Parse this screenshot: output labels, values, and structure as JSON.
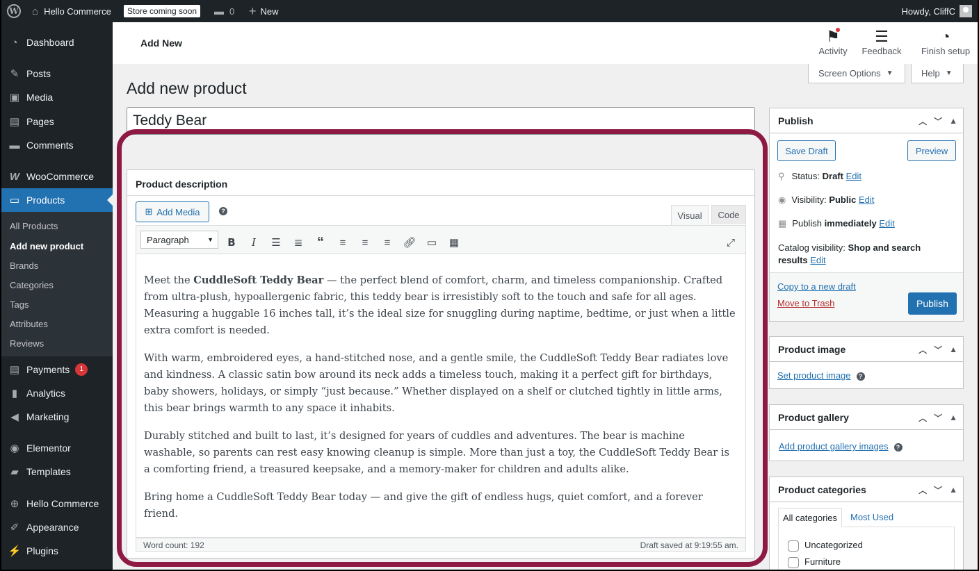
{
  "adminbar": {
    "site_name": "Hello Commerce",
    "store_badge": "Store coming soon",
    "comments_count": "0",
    "new_label": "New",
    "howdy": "Howdy, CliffC"
  },
  "sidebar": {
    "items": [
      {
        "label": "Dashboard",
        "icon": "dashboard-icon"
      },
      {
        "label": "Posts",
        "icon": "pin-icon"
      },
      {
        "label": "Media",
        "icon": "media-icon"
      },
      {
        "label": "Pages",
        "icon": "pages-icon"
      },
      {
        "label": "Comments",
        "icon": "comment-icon"
      },
      {
        "label": "WooCommerce",
        "icon": "woocommerce-icon"
      },
      {
        "label": "Products",
        "icon": "products-icon"
      },
      {
        "label": "Payments",
        "icon": "payments-icon",
        "badge": "1"
      },
      {
        "label": "Analytics",
        "icon": "analytics-icon"
      },
      {
        "label": "Marketing",
        "icon": "megaphone-icon"
      },
      {
        "label": "Elementor",
        "icon": "elementor-icon"
      },
      {
        "label": "Templates",
        "icon": "folder-icon"
      },
      {
        "label": "Hello Commerce",
        "icon": "plus-circle-icon"
      },
      {
        "label": "Appearance",
        "icon": "brush-icon"
      },
      {
        "label": "Plugins",
        "icon": "plug-icon"
      }
    ],
    "submenu": [
      "All Products",
      "Add new product",
      "Brands",
      "Categories",
      "Tags",
      "Attributes",
      "Reviews"
    ]
  },
  "header": {
    "title": "Add New",
    "activity": "Activity",
    "feedback": "Feedback",
    "finish_setup": "Finish setup"
  },
  "screen_options": "Screen Options",
  "help": "Help",
  "page_title": "Add new product",
  "product_title": "Teddy Bear",
  "description": {
    "heading": "Product description",
    "add_media": "Add Media",
    "tab_visual": "Visual",
    "tab_code": "Code",
    "format": "Paragraph",
    "p1_a": "Meet the ",
    "p1_b": "CuddleSoft Teddy Bear",
    "p1_c": " — the perfect blend of comfort, charm, and timeless companionship. Crafted from ultra-plush, hypoallergenic fabric, this teddy bear is irresistibly soft to the touch and safe for all ages. Measuring a huggable 16 inches tall, it’s the ideal size for snuggling during naptime, bedtime, or just when a little extra comfort is needed.",
    "p2": "With warm, embroidered eyes, a hand-stitched nose, and a gentle smile, the CuddleSoft Teddy Bear radiates love and kindness. A classic satin bow around its neck adds a timeless touch, making it a perfect gift for birthdays, baby showers, holidays, or simply “just because.” Whether displayed on a shelf or clutched tightly in little arms, this bear brings warmth to any space it inhabits.",
    "p3": "Durably stitched and built to last, it’s designed for years of cuddles and adventures. The bear is machine washable, so parents can rest easy knowing cleanup is simple. More than just a toy, the CuddleSoft Teddy Bear is a comforting friend, a treasured keepsake, and a memory-maker for children and adults alike.",
    "p4": "Bring home a CuddleSoft Teddy Bear today — and give the gift of endless hugs, quiet comfort, and a forever friend.",
    "word_count": "Word count: 192",
    "draft_saved": "Draft saved at 9:19:55 am."
  },
  "publish": {
    "heading": "Publish",
    "save_draft": "Save Draft",
    "preview": "Preview",
    "status_label": "Status:",
    "status_value": "Draft",
    "visibility_label": "Visibility:",
    "visibility_value": "Public",
    "publish_label": "Publish",
    "publish_value": "immediately",
    "edit": "Edit",
    "catalog_label": "Catalog visibility:",
    "catalog_value_1": "Shop and search",
    "catalog_value_2": "results",
    "copy_draft": "Copy to a new draft",
    "trash": "Move to Trash",
    "publish_button": "Publish"
  },
  "product_image": {
    "heading": "Product image",
    "link": "Set product image"
  },
  "product_gallery": {
    "heading": "Product gallery",
    "link": "Add product gallery images"
  },
  "product_categories": {
    "heading": "Product categories",
    "tab_all": "All categories",
    "tab_used": "Most Used",
    "items": [
      "Uncategorized",
      "Furniture"
    ]
  },
  "colors": {
    "accent": "#2271b1",
    "highlight": "#8e1a44",
    "sidebar": "#1d2327",
    "trash": "#b32d2e"
  }
}
